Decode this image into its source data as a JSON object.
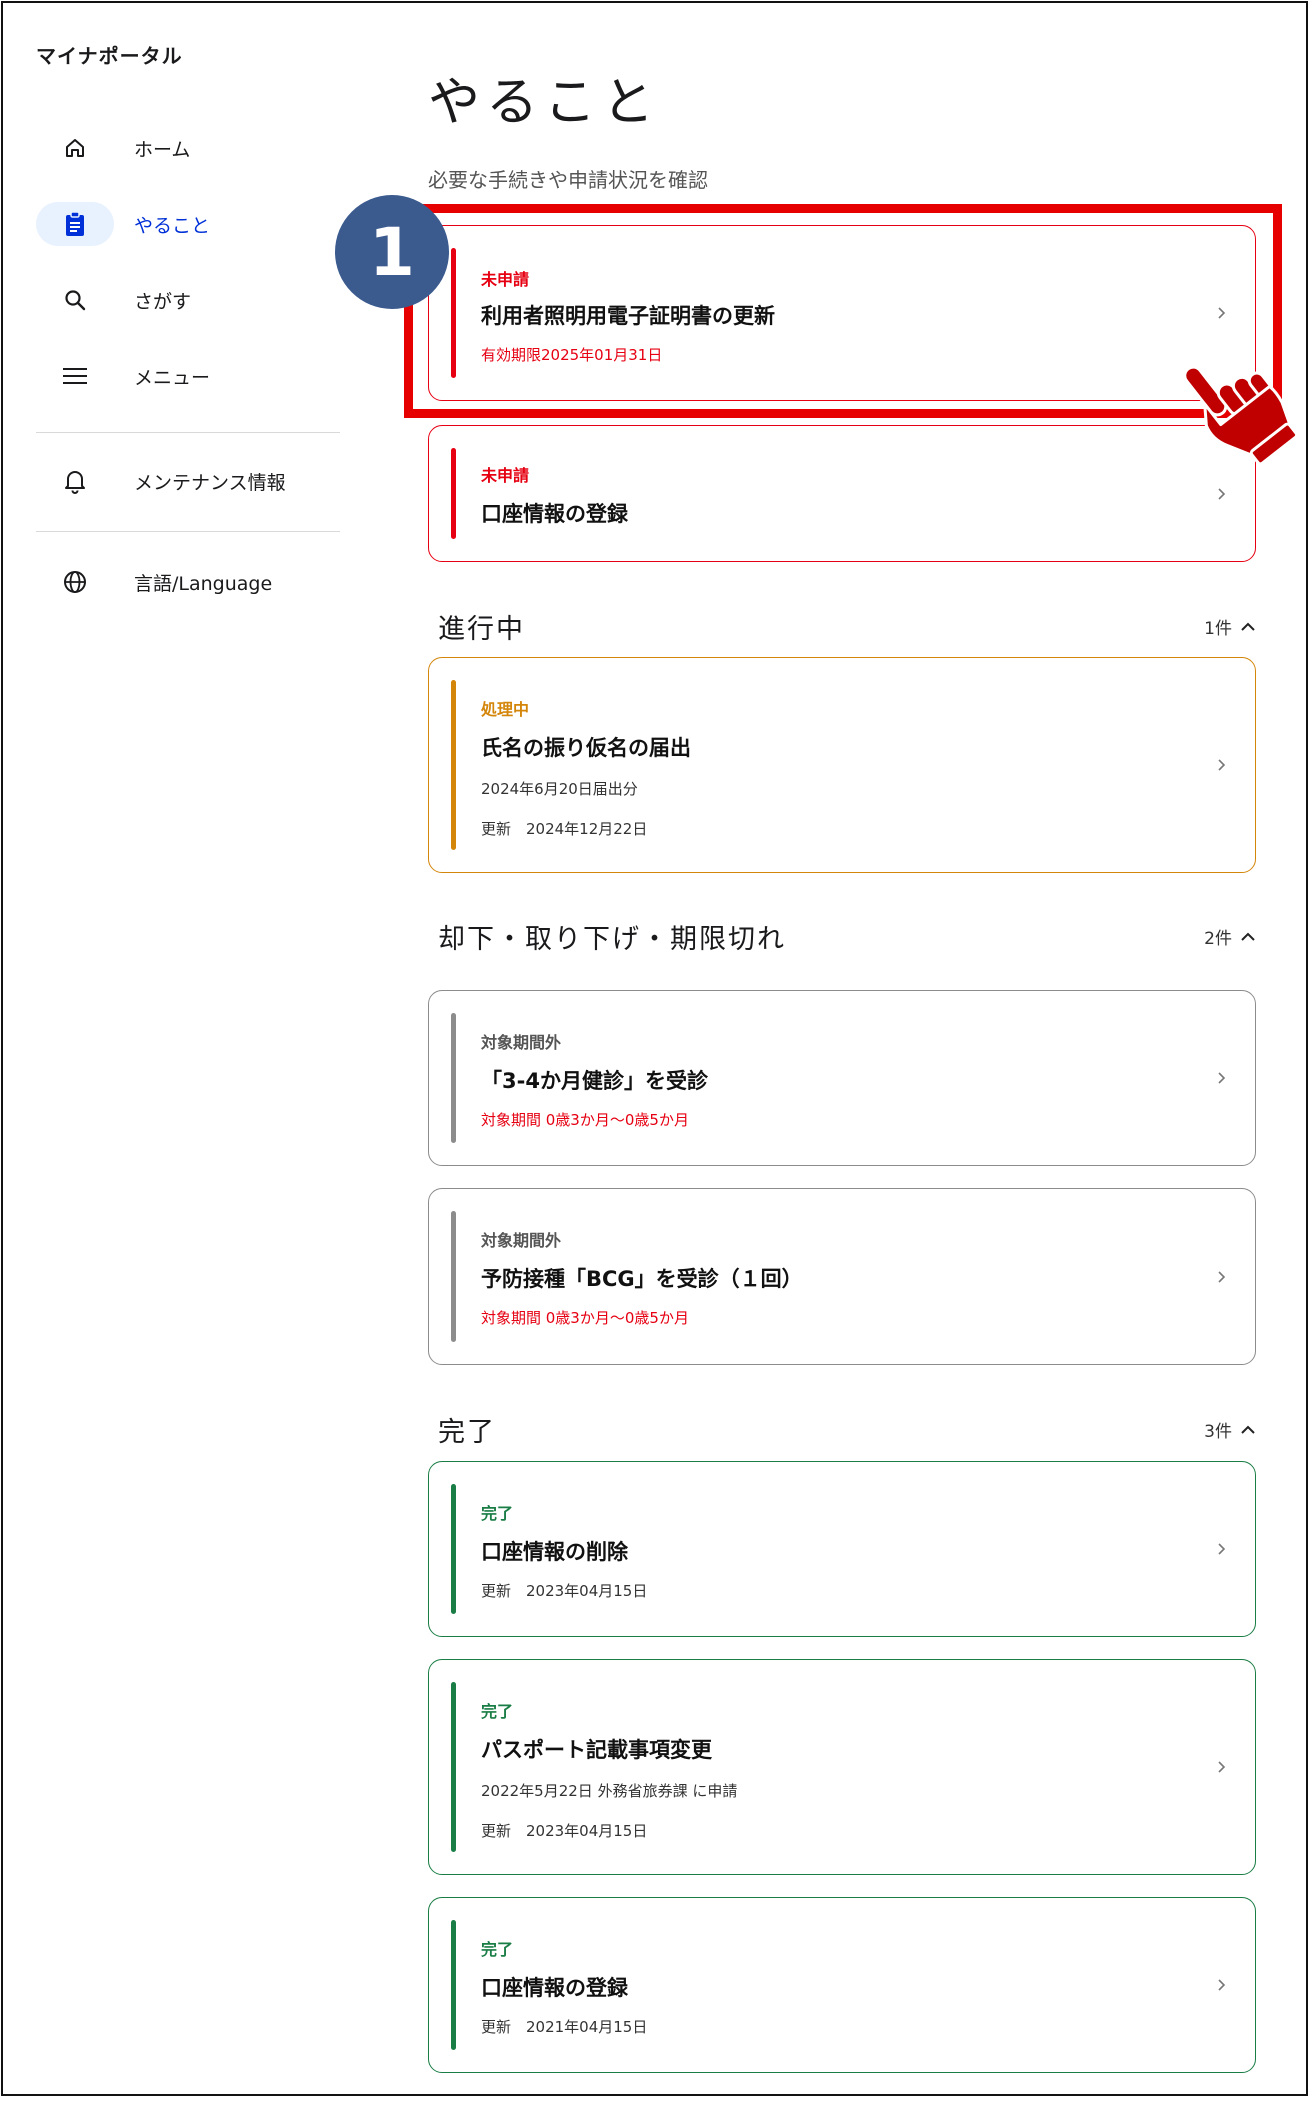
{
  "app": {
    "title": "マイナポータル"
  },
  "sidebar": {
    "items": [
      {
        "label": "ホーム",
        "icon": "home-icon"
      },
      {
        "label": "やること",
        "icon": "clipboard-icon",
        "active": true
      },
      {
        "label": "さがす",
        "icon": "search-icon"
      },
      {
        "label": "メニュー",
        "icon": "menu-icon"
      },
      {
        "label": "メンテナンス情報",
        "icon": "bell-icon"
      },
      {
        "label": "言語/Language",
        "icon": "globe-icon"
      }
    ]
  },
  "main": {
    "title": "やること",
    "subtitle": "必要な手続きや申請状況を確認",
    "step_badge": "1",
    "todo": [
      {
        "status": "未申請",
        "title": "利用者照明用電子証明書の更新",
        "meta": "有効期限2025年01月31日"
      },
      {
        "status": "未申請",
        "title": "口座情報の登録"
      }
    ],
    "in_progress": {
      "title": "進行中",
      "count": "1件",
      "items": [
        {
          "status": "処理中",
          "title": "氏名の振り仮名の届出",
          "meta1": "2024年6月20日届出分",
          "meta2": "更新　2024年12月22日"
        }
      ]
    },
    "rejected": {
      "title": "却下・取り下げ・期限切れ",
      "count": "2件",
      "items": [
        {
          "status": "対象期間外",
          "title": "「3-4か月健診」を受診",
          "meta": "対象期間 0歳3か月～0歳5か月"
        },
        {
          "status": "対象期間外",
          "title": "予防接種「BCG」を受診（１回）",
          "meta": "対象期間 0歳3か月～0歳5か月"
        }
      ]
    },
    "done": {
      "title": "完了",
      "count": "3件",
      "items": [
        {
          "status": "完了",
          "title": "口座情報の削除",
          "meta1": "更新　2023年04月15日"
        },
        {
          "status": "完了",
          "title": "パスポート記載事項変更",
          "meta1": "2022年5月22日 外務省旅券課 に申請",
          "meta2": "更新　2023年04月15日"
        },
        {
          "status": "完了",
          "title": "口座情報の登録",
          "meta1": "更新　2021年04月15日"
        }
      ]
    }
  },
  "colors": {
    "red": "#e60012",
    "orange": "#d4860b",
    "gray": "#8c8c8c",
    "green": "#1a7d45",
    "active_blue": "#0031d8",
    "badge": "#3b5a8e"
  }
}
